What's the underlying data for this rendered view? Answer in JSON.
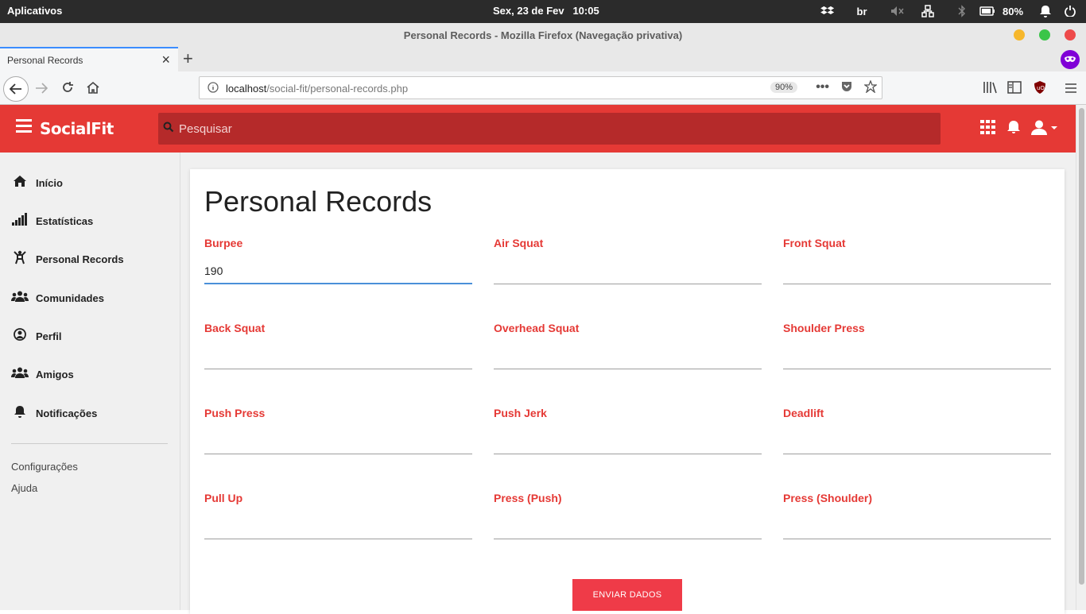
{
  "system": {
    "apps_label": "Aplicativos",
    "clock": "Sex, 23 de Fev   10:05",
    "keyboard_layout": "br",
    "battery": "80%"
  },
  "browser": {
    "window_title": "Personal Records - Mozilla Firefox (Navegação privativa)",
    "tab_label": "Personal Records",
    "url_host": "localhost",
    "url_path": "/social-fit/personal-records.php",
    "zoom": "90%",
    "colors": {
      "private": "#8000d7",
      "tab_accent": "#3c8dff"
    }
  },
  "app": {
    "logo": "SocialFit",
    "search_placeholder": "Pesquisar",
    "colors": {
      "primary": "#e53935",
      "search_bg": "#b52a2a",
      "button": "#ef3b48"
    }
  },
  "sidebar": {
    "items": [
      {
        "label": "Início",
        "icon": "home-icon"
      },
      {
        "label": "Estatísticas",
        "icon": "signal-icon"
      },
      {
        "label": "Personal Records",
        "icon": "athlete-icon"
      },
      {
        "label": "Comunidades",
        "icon": "group-icon"
      },
      {
        "label": "Perfil",
        "icon": "user-circle-icon"
      },
      {
        "label": "Amigos",
        "icon": "friends-icon"
      },
      {
        "label": "Notificações",
        "icon": "bell-icon"
      }
    ],
    "links": [
      "Configurações",
      "Ajuda"
    ]
  },
  "main": {
    "title": "Personal Records",
    "fields": [
      {
        "label": "Burpee",
        "value": "190"
      },
      {
        "label": "Air Squat",
        "value": ""
      },
      {
        "label": "Front Squat",
        "value": ""
      },
      {
        "label": "Back Squat",
        "value": ""
      },
      {
        "label": "Overhead Squat",
        "value": ""
      },
      {
        "label": "Shoulder Press",
        "value": ""
      },
      {
        "label": "Push Press",
        "value": ""
      },
      {
        "label": "Push Jerk",
        "value": ""
      },
      {
        "label": "Deadlift",
        "value": ""
      },
      {
        "label": "Pull Up",
        "value": ""
      },
      {
        "label": "Press (Push)",
        "value": ""
      },
      {
        "label": "Press (Shoulder)",
        "value": ""
      }
    ],
    "submit_label": "ENVIAR DADOS"
  }
}
